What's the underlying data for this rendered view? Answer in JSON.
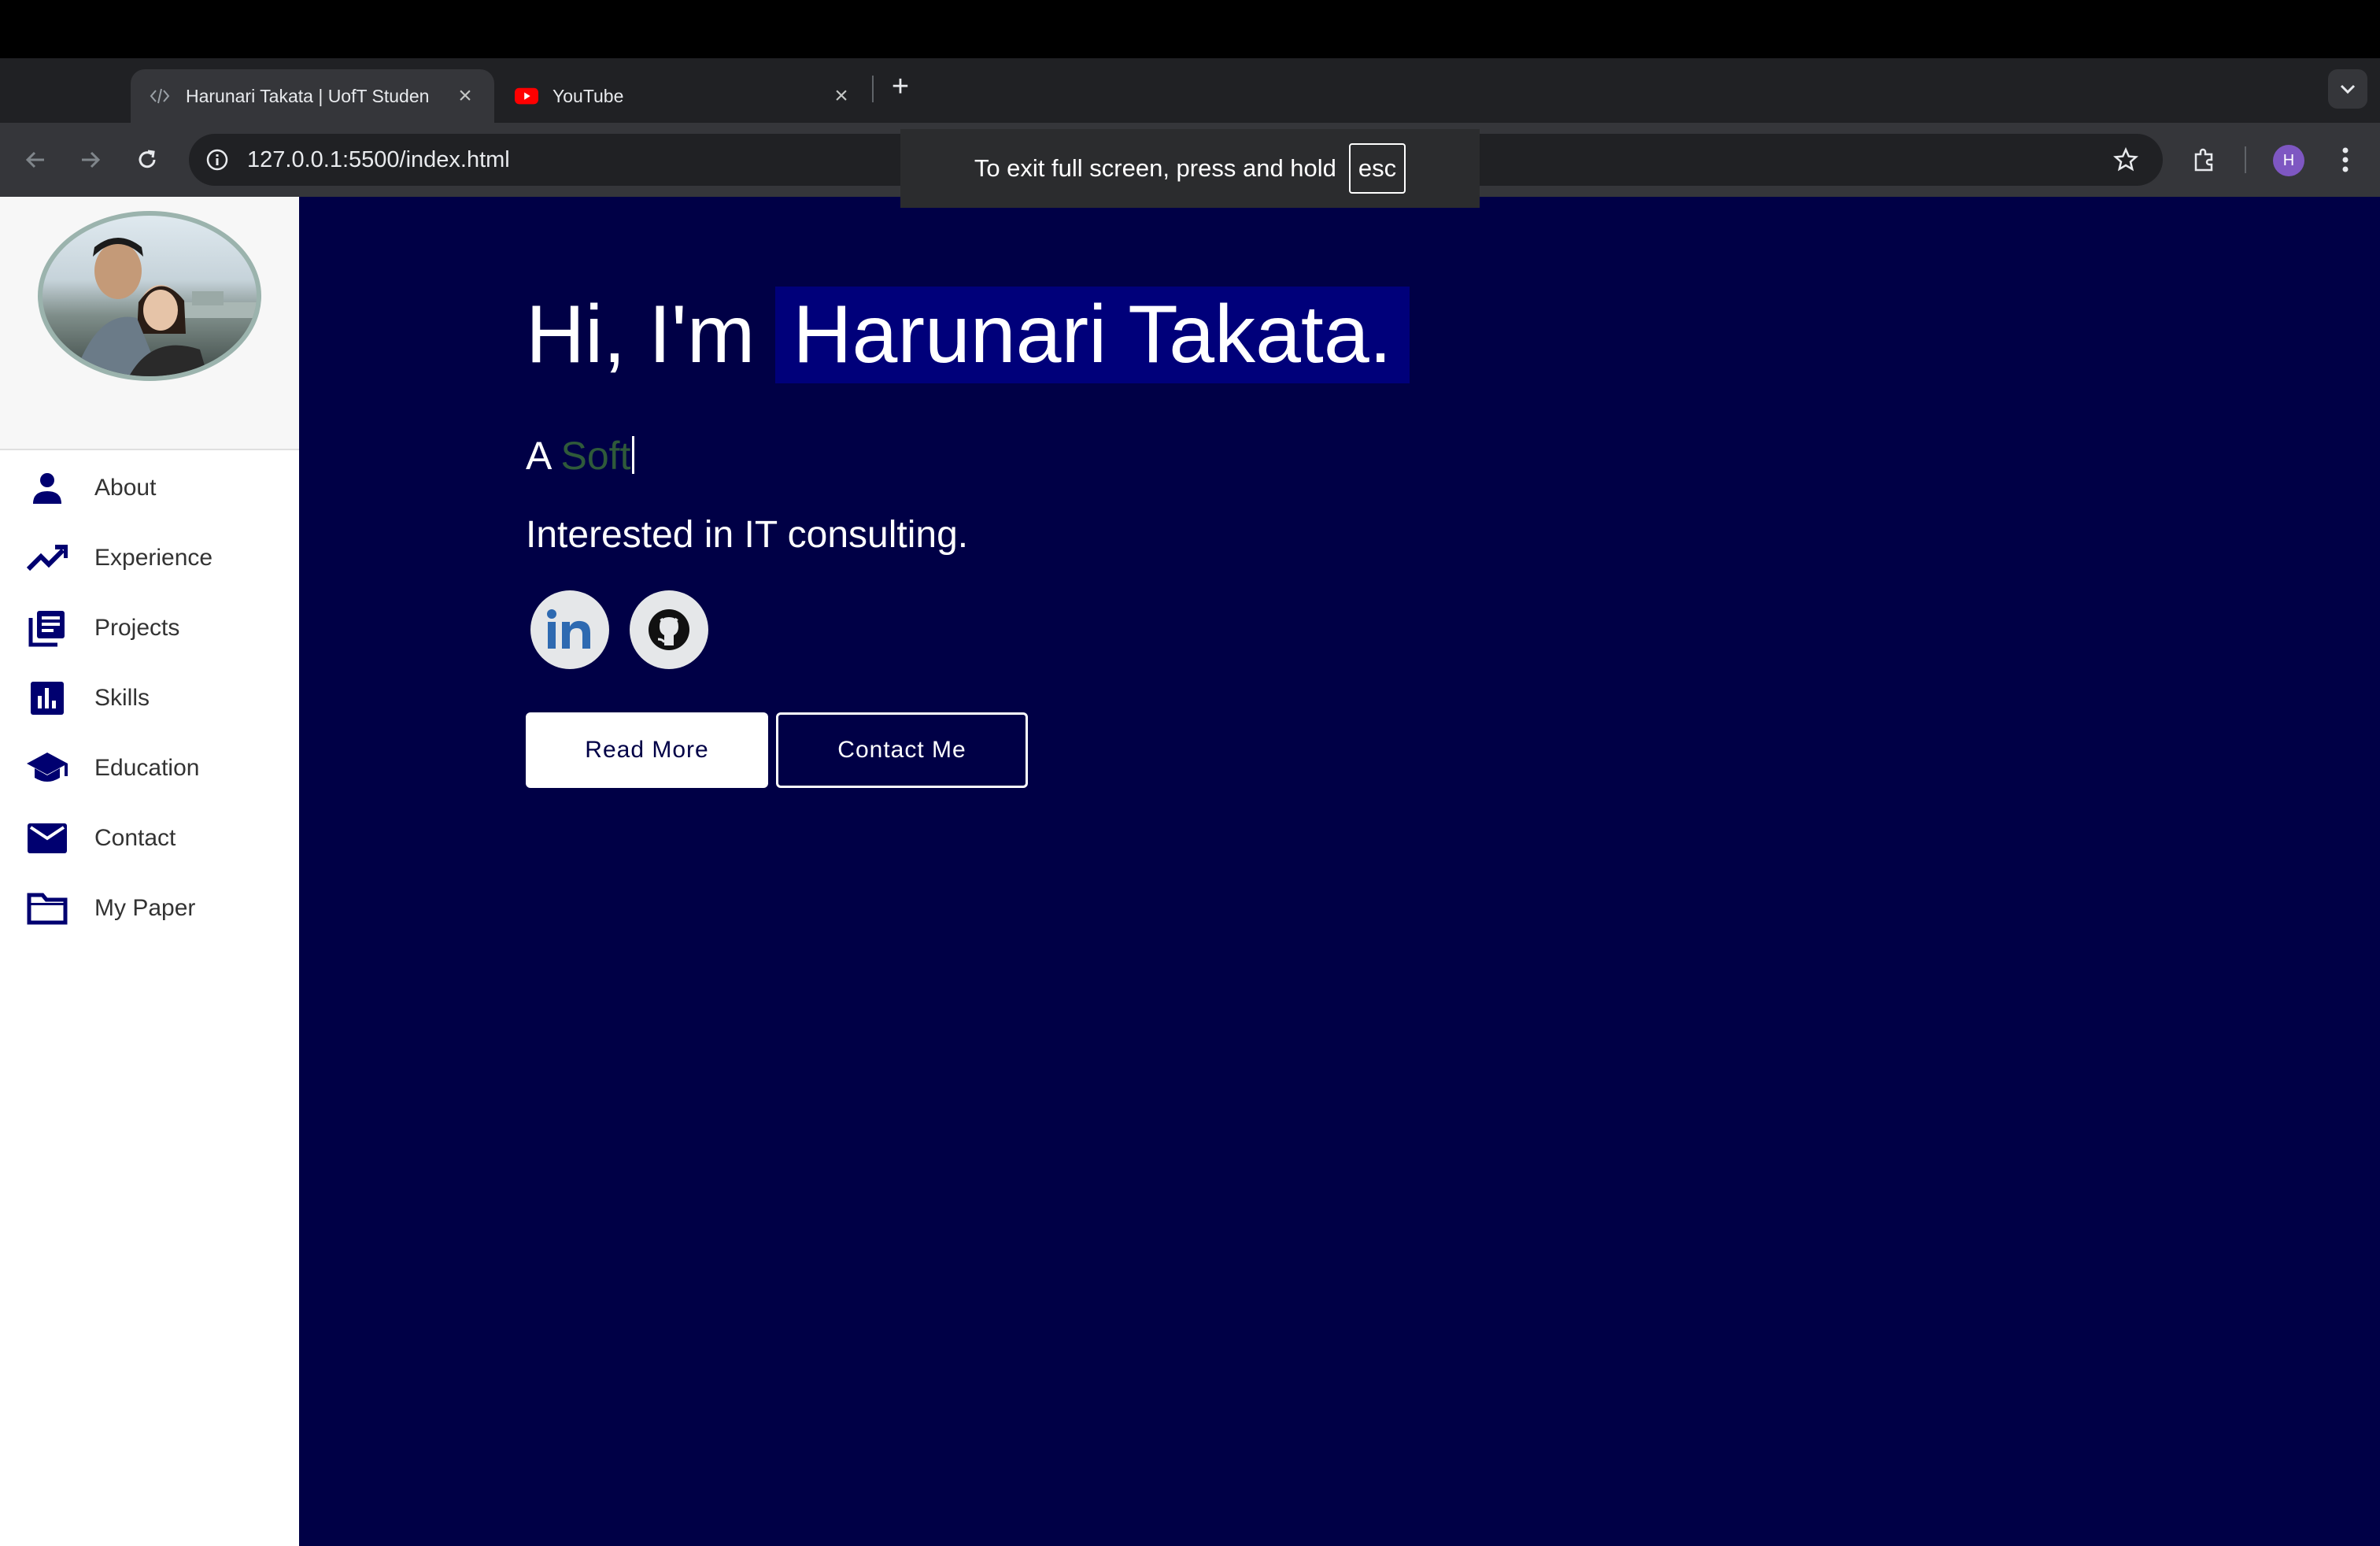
{
  "browser": {
    "tabs": [
      {
        "title": "Harunari Takata | UofT Studen",
        "icon": "code-icon",
        "active": true
      },
      {
        "title": "YouTube",
        "icon": "youtube-icon",
        "active": false
      }
    ],
    "url": "127.0.0.1:5500/index.html",
    "profile_initial": "H",
    "fullscreen_notice": "To exit full screen, press and hold",
    "fullscreen_key": "esc"
  },
  "sidebar": {
    "avatar_alt": "profile photo",
    "items": [
      {
        "label": "About",
        "icon": "person-icon"
      },
      {
        "label": "Experience",
        "icon": "trending-up-icon"
      },
      {
        "label": "Projects",
        "icon": "article-icon"
      },
      {
        "label": "Skills",
        "icon": "bar-chart-icon"
      },
      {
        "label": "Education",
        "icon": "graduation-cap-icon"
      },
      {
        "label": "Contact",
        "icon": "mail-icon"
      },
      {
        "label": "My Paper",
        "icon": "folder-icon"
      }
    ]
  },
  "hero": {
    "greeting": "Hi, I'm",
    "name": "Harunari Takata.",
    "typed_prefix": "A",
    "typed_word": "Soft",
    "interest": "Interested in IT consulting.",
    "read_more": "Read More",
    "contact_me": "Contact Me"
  },
  "colors": {
    "main_bg": "#000046",
    "name_highlight": "#00007a",
    "nav_icon": "#000070",
    "linkedin": "#2e6ab1",
    "typed_word": "#2f5a3a"
  }
}
